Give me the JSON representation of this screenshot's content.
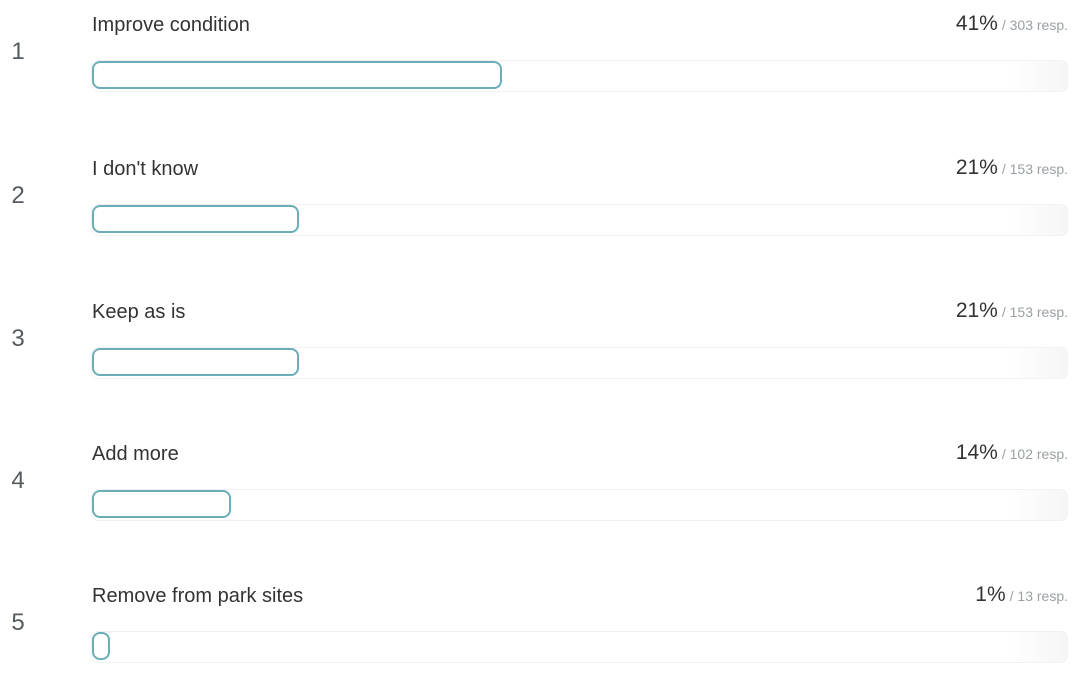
{
  "results": [
    {
      "rank": "1",
      "label": "Improve condition",
      "percent_text": "41%",
      "responses_text": "/ 303 resp.",
      "fraction": 0.42
    },
    {
      "rank": "2",
      "label": "I don't know",
      "percent_text": "21%",
      "responses_text": "/ 153 resp.",
      "fraction": 0.212
    },
    {
      "rank": "3",
      "label": "Keep as is",
      "percent_text": "21%",
      "responses_text": "/ 153 resp.",
      "fraction": 0.212
    },
    {
      "rank": "4",
      "label": "Add more",
      "percent_text": "14%",
      "responses_text": "/ 102 resp.",
      "fraction": 0.143
    },
    {
      "rank": "5",
      "label": "Remove from park sites",
      "percent_text": "1%",
      "responses_text": "/ 13 resp.",
      "fraction": 0.018
    }
  ],
  "colors": {
    "bar_border": "#6aaeb8",
    "text": "#333333",
    "muted": "#9aa0a4"
  }
}
